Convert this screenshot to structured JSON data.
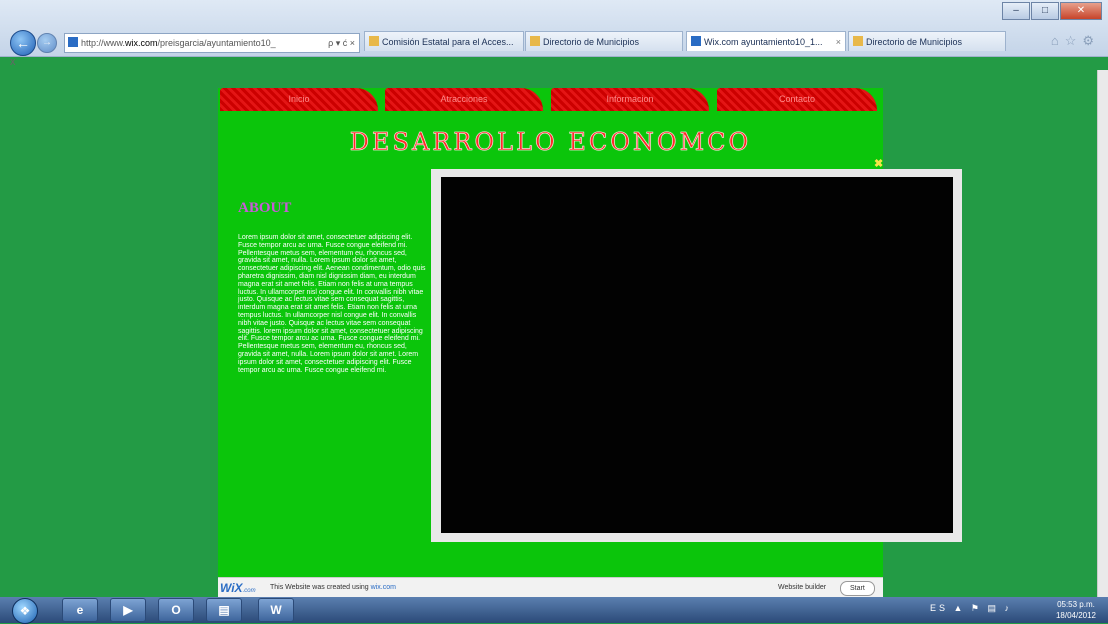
{
  "browser": {
    "address": {
      "prefix": "http://www.",
      "domain": "wix.com",
      "path": "/preisgarcia/ayuntamiento10_",
      "actions": "ρ ▾ ć ×"
    },
    "tabs": [
      {
        "label": "Comisión Estatal para el Acces...",
        "icon": "page-icon"
      },
      {
        "label": "Directorio de Municipios",
        "icon": "page-icon"
      },
      {
        "label": "Wix.com ayuntamiento10_1...",
        "icon": "wix-icon",
        "active": true
      },
      {
        "label": "Directorio de Municipios",
        "icon": "page-icon"
      }
    ],
    "close_bar": "x"
  },
  "site": {
    "menu": [
      {
        "label": "Inicio"
      },
      {
        "label": "Atracciones"
      },
      {
        "label": "Informacion"
      },
      {
        "label": "Contacto"
      }
    ],
    "heading": "DESARROLLO ECONOMCO",
    "about_title": "ABOUT",
    "about_text": "Lorem ipsum dolor sit amet, consectetuer adipiscing elit. Fusce tempor arcu ac urna. Fusce congue eleifend mi. Pellentesque metus sem, elementum eu, rhoncus sed, gravida sit amet, nulla. Lorem ipsum dolor sit amet, consectetuer adipiscing elit. Aenean condimentum, odio quis pharetra dignissim, diam nisl dignissim diam, eu interdum magna erat sit amet felis. Etiam non felis at urna tempus luctus. In ullamcorper nisl congue elit. In convallis nibh vitae justo. Quisque ac lectus vitae sem consequat sagittis, interdum magna erat sit amet felis. Etiam non felis at urna tempus luctus. In ullamcorper nisl congue elit. In convallis nibh vitae justo. Quisque ac lectus vitae sem consequat sagittis. lorem ipsum dolor sit amet, consectetuer adipiscing elit. Fusce tempor arcu ac urna. Fusce congue eleifend mi. Pellentesque metus sem, elementum eu, rhoncus sed, gravida sit amet, nulla. Lorem ipsum dolor sit amet. Lorem ipsum dolor sit amet, consectetuer adipiscing elit. Fusce tempor arcu ac urna. Fusce congue eleifend mi.",
    "wix_bar": {
      "logo": "WiX",
      "logo_suffix": ".com",
      "message": "This Website was created using",
      "link": "wix.com",
      "builder": "Website builder",
      "start": "Start"
    }
  },
  "taskbar": {
    "apps": [
      "ie-icon",
      "media-player-icon",
      "outlook-icon",
      "explorer-icon",
      "word-icon"
    ],
    "app_labels": {
      "outlook": "O",
      "word": "W"
    },
    "tray": "ES",
    "time": "05:53 p.m.",
    "date": "18/04/2012"
  },
  "colors": {
    "page_bg": "#239B45",
    "site_bg": "#0BC50B",
    "menu_red": "#CC0000",
    "heading_red": "#FF2A2A",
    "about_title": "#C85AD8",
    "lightbox": "#020202"
  }
}
